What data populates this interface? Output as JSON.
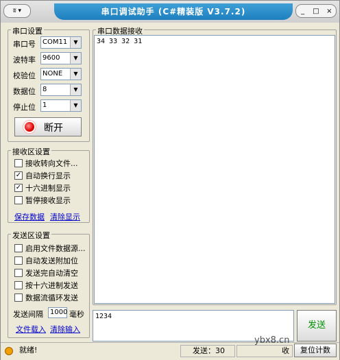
{
  "window": {
    "sysmenu_label": "▾",
    "title": "串口调试助手 (C#精装版 V3.7.2)",
    "min": "_",
    "max": "□",
    "close": "×"
  },
  "serial": {
    "group_title": "串口设置",
    "port_label": "串口号",
    "port_value": "COM11",
    "baud_label": "波特率",
    "baud_value": "9600",
    "parity_label": "校验位",
    "parity_value": "NONE",
    "databits_label": "数据位",
    "databits_value": "8",
    "stopbits_label": "停止位",
    "stopbits_value": "1",
    "toggle_label": "断开"
  },
  "receive_settings": {
    "group_title": "接收区设置",
    "options": [
      {
        "label": "接收转向文件...",
        "checked": false
      },
      {
        "label": "自动换行显示",
        "checked": true
      },
      {
        "label": "十六进制显示",
        "checked": true
      },
      {
        "label": "暂停接收显示",
        "checked": false
      }
    ],
    "save_label": "保存数据",
    "clear_label": "清除显示"
  },
  "send_settings": {
    "group_title": "发送区设置",
    "options": [
      {
        "label": "启用文件数据源...",
        "checked": false
      },
      {
        "label": "自动发送附加位",
        "checked": false
      },
      {
        "label": "发送完自动清空",
        "checked": false
      },
      {
        "label": "按十六进制发送",
        "checked": false
      },
      {
        "label": "数据流循环发送",
        "checked": false
      }
    ],
    "interval_label": "发送间隔",
    "interval_value": "1000",
    "interval_unit": "毫秒",
    "load_file_label": "文件载入",
    "clear_input_label": "清除输入"
  },
  "receive_area": {
    "group_title": "串口数据接收",
    "content": "34 33 32 31"
  },
  "send_area": {
    "content": "1234",
    "send_label": "发送"
  },
  "status": {
    "ready": "就绪!",
    "sent": "发送：30",
    "recv": "收",
    "reset_label": "复位计数"
  },
  "watermark": "ybx8.cn"
}
